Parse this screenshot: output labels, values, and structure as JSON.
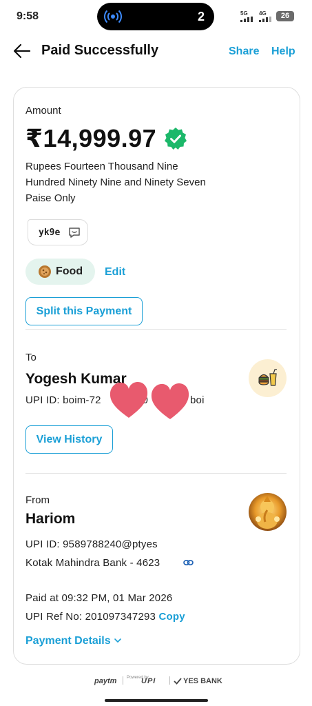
{
  "status_bar": {
    "time": "9:58",
    "island_count": "2",
    "signal_1": "5G",
    "signal_2": "4G",
    "battery": "26"
  },
  "header": {
    "title": "Paid Successfully",
    "share": "Share",
    "help": "Help"
  },
  "amount": {
    "label": "Amount",
    "value": "₹14,999.97",
    "words_lines": [
      "Rupees Fourteen Thousand Nine",
      "Hundred Ninety Nine and Ninety Seven",
      "Paise Only"
    ]
  },
  "note": {
    "text": "yk9e",
    "icon": "message-icon"
  },
  "category": {
    "label": "Food",
    "edit": "Edit",
    "icon": "food-plate-icon"
  },
  "split_button": "Split this Payment",
  "to": {
    "label": "To",
    "name": "Yogesh Kumar",
    "upi_visible_start": "UPI ID: boim-72",
    "upi_visible_mid": "90",
    "upi_visible_end": "boi",
    "view_history": "View History",
    "avatar_icon": "burger-drink-icon"
  },
  "from": {
    "label": "From",
    "name": "Hariom",
    "upi": "UPI ID: 9589788240@ptyes",
    "bank": "Kotak Mahindra Bank - 4623",
    "bank_icon": "link-icon",
    "paid_at": "Paid at 09:32 PM, 01 Mar 2026",
    "ref_prefix": "UPI Ref No: 201097347293",
    "copy": "Copy"
  },
  "payment_details": "Payment Details",
  "footer": {
    "paytm": "paytm",
    "powered": "Powered by",
    "upi": "UPI",
    "bank": "YES BANK"
  },
  "colors": {
    "accent": "#1a9fd6",
    "verified": "#1cb86a",
    "chip_bg": "#e4f4ee",
    "heart": "#e85a6e"
  }
}
